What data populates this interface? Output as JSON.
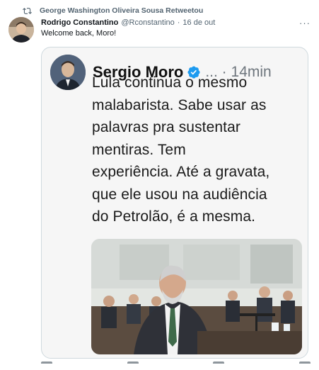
{
  "retweet": {
    "text": "George Washington Oliveira Sousa Retweetou"
  },
  "tweet": {
    "author_name": "Rodrigo Constantino",
    "handle": "@Rconstantino",
    "dot": "·",
    "date": "16 de out",
    "more": "···",
    "text": "Welcome back, Moro!"
  },
  "embedded": {
    "author_name": "Sergio Moro",
    "rest": "... · 14min",
    "lines": [
      "Lula continua o mesmo",
      "malabarista. Sabe usar as",
      "palavras pra sustentar",
      "mentiras. Tem",
      "experiência. Até a gravata,",
      "que ele usou na audiência",
      "do Petrolão, é a mesma."
    ]
  },
  "colors": {
    "verified": "#1d9bf0",
    "secondary_text": "#536471",
    "border": "#cfd9de"
  },
  "icons": [
    "retweet-icon",
    "more-icon",
    "verified-icon"
  ]
}
